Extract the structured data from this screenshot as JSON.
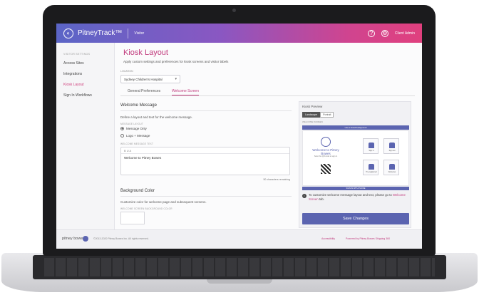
{
  "topbar": {
    "brand": "PitneyTrack™",
    "tab": "Visitor",
    "user": "Client Admin",
    "help_icon": "help-circle-icon",
    "settings_icon": "gear-icon"
  },
  "sidebar": {
    "heading": "VISITOR SETTINGS",
    "items": [
      {
        "label": "Access Sites"
      },
      {
        "label": "Integrations"
      },
      {
        "label": "Kiosk Layout"
      },
      {
        "label": "Sign In Workflows"
      }
    ]
  },
  "main": {
    "title": "Kiosk Layout",
    "subtitle": "Apply custom settings and preferences for kiosk screens and visitor labels",
    "location_label": "LOCATION",
    "location_value": "Sydney Children's Hospital",
    "tabs": [
      {
        "label": "General Preferences"
      },
      {
        "label": "Welcome Screen"
      }
    ],
    "welcome_section": {
      "title": "Welcome Message",
      "description": "Define a layout and text for the welcome message.",
      "layout_label": "MESSAGE LAYOUT",
      "options": [
        {
          "label": "Message Only"
        },
        {
          "label": "Logo + Message"
        }
      ],
      "text_label": "WELCOME MESSAGE TEXT",
      "toolbar": "B  U  A",
      "text_value": "Welcome to Pitney Bowes",
      "char_count": "50 characters remaining"
    },
    "background_section": {
      "title": "Background Color",
      "description": "Customize color for welcome page and subsequent screens.",
      "color_label": "WELCOME SCREEN BACKGROUND COLOR"
    }
  },
  "preview": {
    "title": "Kiosk Preview",
    "toggle": [
      "Landscape",
      "Portrait"
    ],
    "screen_label": "WELCOME SCREEN",
    "top_bar": "Use a brand background",
    "welcome": "Welcome to Pitney Bowes",
    "scan_text": "Scan the QR code to sign in",
    "tiles": [
      "Sign in",
      "Sign out",
      "Pre-registered",
      "Deliveries"
    ],
    "bottom_bar": "SIGN IN WITH PHONE",
    "info": "To customize welcome message layout and text, please go to",
    "info_link": "Welcome Screen",
    "info_tail": "tab.",
    "save": "Save Changes"
  },
  "footer": {
    "brand": "pitney bowes",
    "copyright": "©2013-2020 Pitney Bowes Inc. All rights reserved.",
    "accessibility": "Accessibility",
    "powered": "Powered by Pitney Bowes Shipping 360"
  },
  "colors": {
    "accent": "#c13b7d",
    "primary": "#5b64b0",
    "gradient_start": "#5b65c6",
    "gradient_end": "#e0407e"
  }
}
